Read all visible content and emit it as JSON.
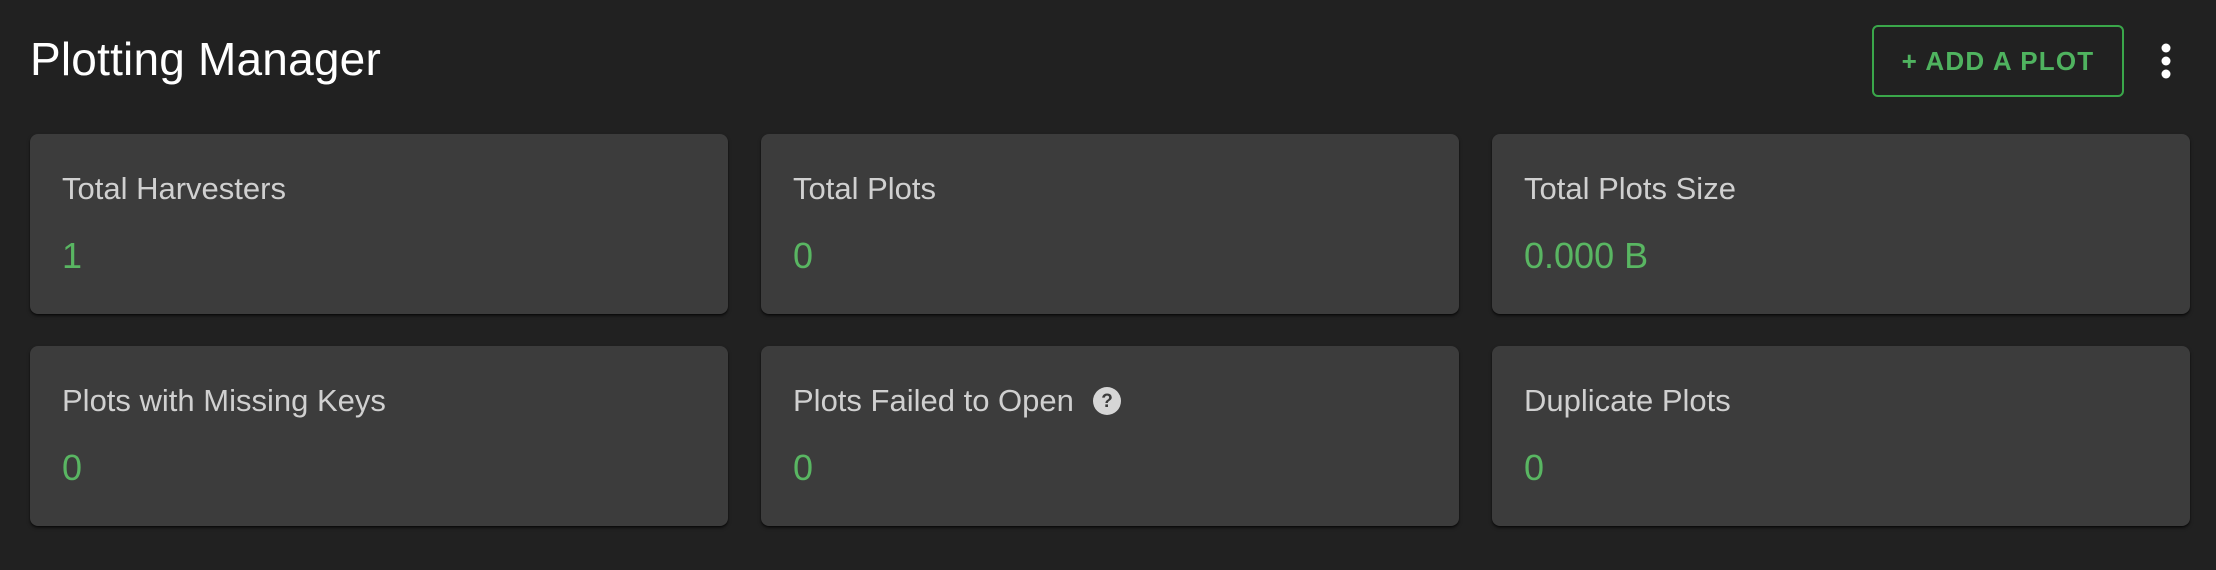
{
  "header": {
    "title": "Plotting Manager",
    "add_plot_label": "+ ADD A PLOT",
    "more_icon": "more-vert-icon"
  },
  "colors": {
    "background": "#212121",
    "card": "#3c3c3c",
    "accent": "#59b662",
    "label": "#d0d0d0"
  },
  "stats": [
    {
      "label": "Total Harvesters",
      "value": "1"
    },
    {
      "label": "Total Plots",
      "value": "0"
    },
    {
      "label": "Total Plots Size",
      "value": "0.000 B"
    },
    {
      "label": "Plots with Missing Keys",
      "value": "0"
    },
    {
      "label": "Plots Failed to Open",
      "value": "0",
      "icon": "help-icon"
    },
    {
      "label": "Duplicate Plots",
      "value": "0"
    }
  ]
}
